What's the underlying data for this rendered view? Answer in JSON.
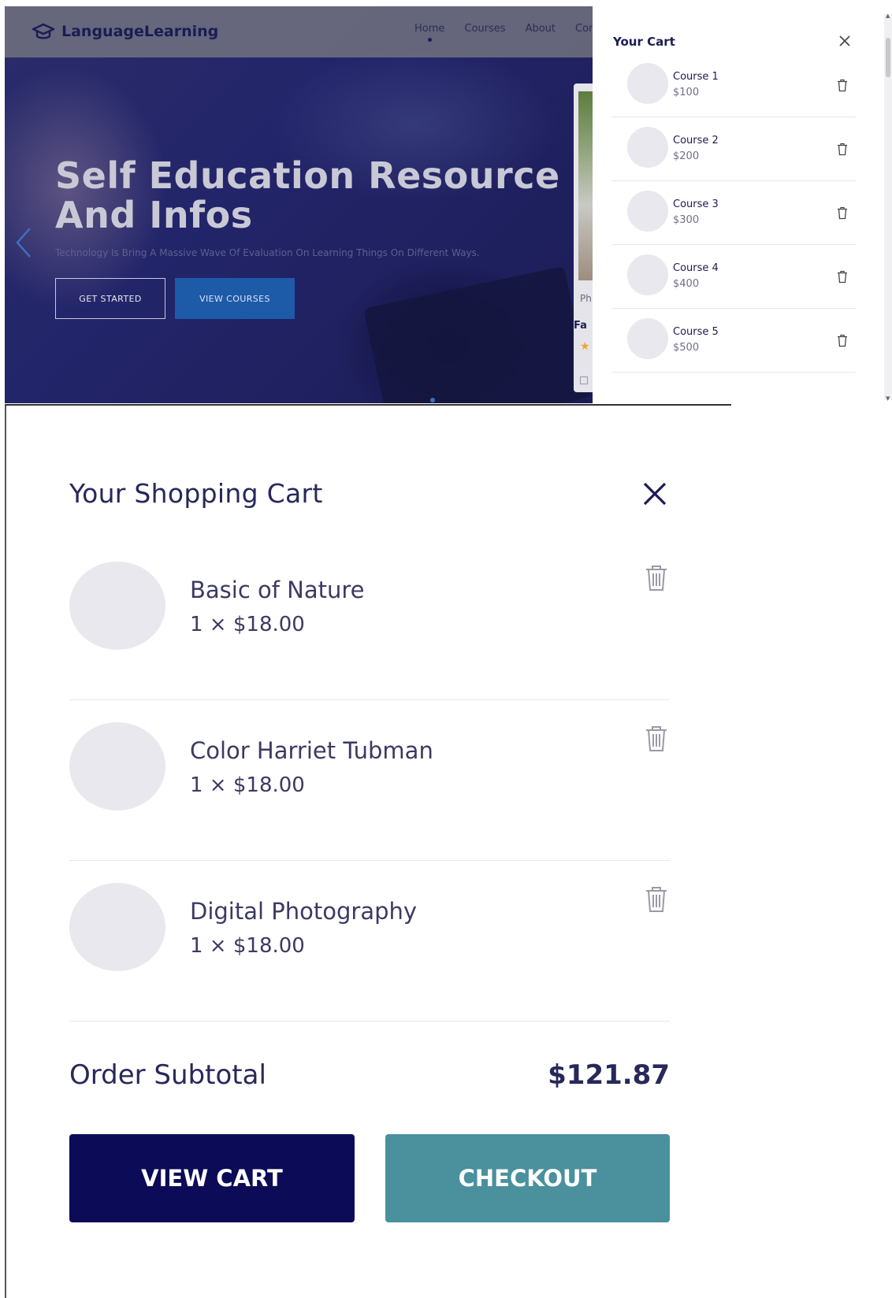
{
  "site": {
    "logo_text": "LanguageLearning",
    "nav": [
      "Home",
      "Courses",
      "About",
      "Conta"
    ],
    "hero_title": "Self Education Resource And Infos",
    "hero_subtitle": "Technology Is Bring A Massive Wave Of Evaluation On Learning Things On Different Ways.",
    "get_started_label": "GET STARTED",
    "view_courses_label": "VIEW COURSES",
    "side_card": {
      "text1": "Ph",
      "text2": "Fa"
    }
  },
  "mini_cart": {
    "title": "Your Cart",
    "items": [
      {
        "name": "Course 1",
        "price": "$100"
      },
      {
        "name": "Course 2",
        "price": "$200"
      },
      {
        "name": "Course 3",
        "price": "$300"
      },
      {
        "name": "Course 4",
        "price": "$400"
      },
      {
        "name": "Course 5",
        "price": "$500"
      }
    ]
  },
  "cart": {
    "title": "Your Shopping Cart",
    "items": [
      {
        "name": "Basic of Nature",
        "qty": "1 × $18.00"
      },
      {
        "name": "Color Harriet Tubman",
        "qty": "1 × $18.00"
      },
      {
        "name": "Digital Photography",
        "qty": "1 × $18.00"
      }
    ],
    "subtotal_label": "Order Subtotal",
    "subtotal_value": "$121.87",
    "view_cart_label": "VIEW CART",
    "checkout_label": "CHECKOUT"
  },
  "colors": {
    "navy": "#0c0b57",
    "teal": "#4a909d",
    "hero_button": "#1d5aa8",
    "text_dark": "#27285a"
  }
}
